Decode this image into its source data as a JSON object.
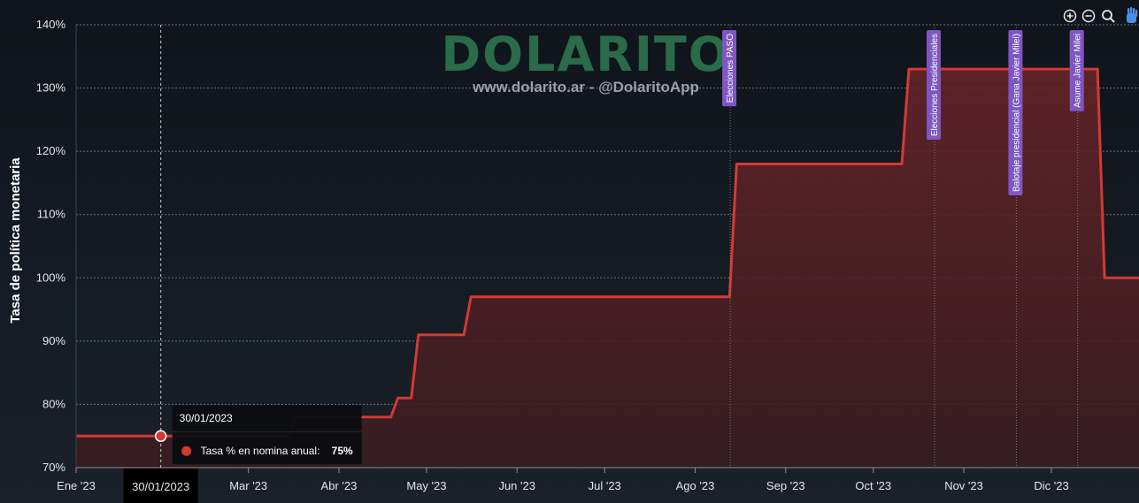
{
  "watermark": {
    "brand": "DOLARITO",
    "handle": "www.dolarito.ar - @DolaritoApp"
  },
  "toolbar": {
    "zoom_in_icon": "zoom-in-icon",
    "zoom_out_icon": "zoom-out-icon",
    "search_icon": "magnifier-icon",
    "pan_icon": "hand-icon"
  },
  "crosshair": {
    "date_label": "30/01/2023"
  },
  "tooltip": {
    "title": "30/01/2023",
    "series_label": "Tasa % en nomina anual:",
    "value_label": "75%"
  },
  "colors": {
    "background": "#121820",
    "line": "#d23a35",
    "fill": "#5a2226",
    "grid": "#6c7580",
    "annotation": "#7e57c2",
    "brand": "#2a6b4a"
  },
  "chart_data": {
    "type": "area",
    "title": "",
    "xlabel": "",
    "ylabel": "Tasa de política monetaria",
    "ylim": [
      70,
      140
    ],
    "y_ticks": [
      "70%",
      "80%",
      "90%",
      "100%",
      "110%",
      "120%",
      "130%",
      "140%"
    ],
    "y_tick_values": [
      70,
      80,
      90,
      100,
      110,
      120,
      130,
      140
    ],
    "x_ticks": [
      "Ene '23",
      "Mar '23",
      "Abr '23",
      "May '23",
      "Jun '23",
      "Jul '23",
      "Ago '23",
      "Sep '23",
      "Oct '23",
      "Nov '23",
      "Dic '23"
    ],
    "x_tick_dates": [
      "2023-01-01",
      "2023-03-01",
      "2023-04-01",
      "2023-05-01",
      "2023-06-01",
      "2023-07-01",
      "2023-08-01",
      "2023-09-01",
      "2023-10-01",
      "2023-11-01",
      "2023-12-01"
    ],
    "x_range": [
      "2023-01-01",
      "2023-12-31"
    ],
    "grid": true,
    "series": [
      {
        "name": "Tasa % en nomina anual",
        "points": [
          {
            "date": "2023-01-01",
            "value": 75
          },
          {
            "date": "2023-03-16",
            "value": 78
          },
          {
            "date": "2023-04-20",
            "value": 81
          },
          {
            "date": "2023-04-27",
            "value": 91
          },
          {
            "date": "2023-05-15",
            "value": 97
          },
          {
            "date": "2023-08-14",
            "value": 118
          },
          {
            "date": "2023-10-12",
            "value": 133
          },
          {
            "date": "2023-12-18",
            "value": 100
          },
          {
            "date": "2023-12-31",
            "value": 100
          }
        ]
      }
    ],
    "annotations": [
      {
        "label": "Elecciones PASO",
        "date": "2023-08-13"
      },
      {
        "label": "Elecciones Presidenciales",
        "date": "2023-10-22"
      },
      {
        "label": "Balotaje presidencial (Gana Javier Milei)",
        "date": "2023-11-19"
      },
      {
        "label": "Asume Javier Milei",
        "date": "2023-12-10"
      }
    ],
    "hover": {
      "date": "2023-01-30",
      "value": 75
    }
  }
}
